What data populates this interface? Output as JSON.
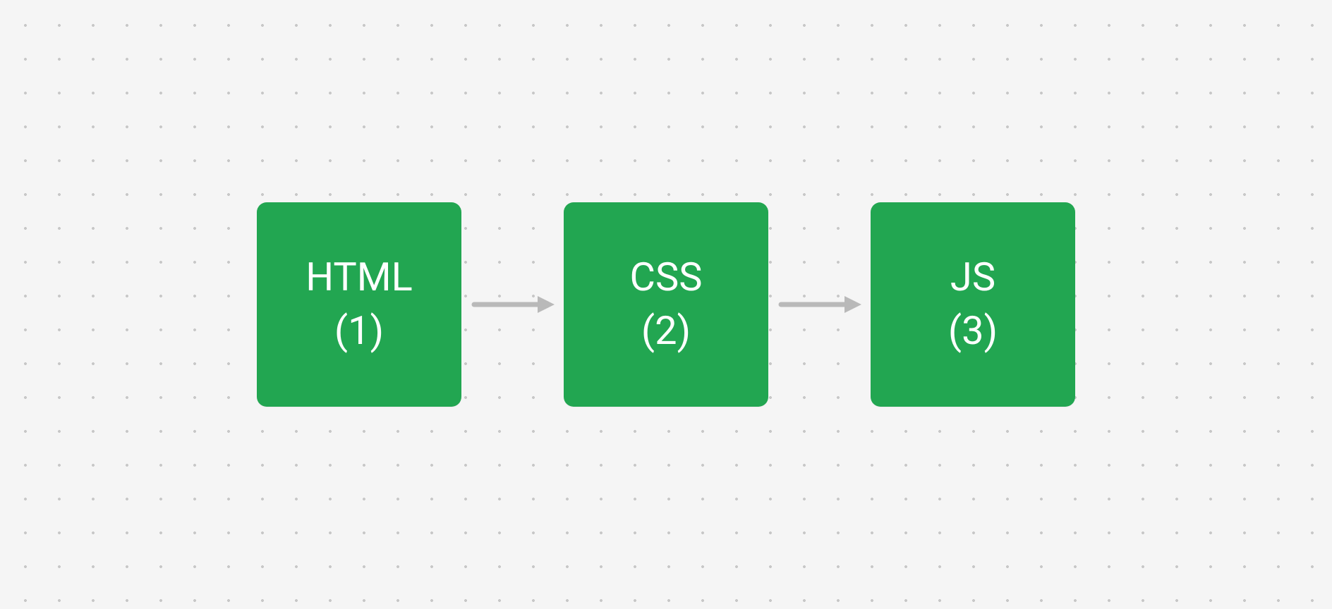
{
  "colors": {
    "node_bg": "#22a651",
    "node_text": "#ffffff",
    "arrow": "#b9b9b9",
    "canvas_bg": "#f5f5f5",
    "dot": "#c8c8c8"
  },
  "nodes": [
    {
      "title": "HTML",
      "sub": "(1)"
    },
    {
      "title": "CSS",
      "sub": "(2)"
    },
    {
      "title": "JS",
      "sub": "(3)"
    }
  ]
}
